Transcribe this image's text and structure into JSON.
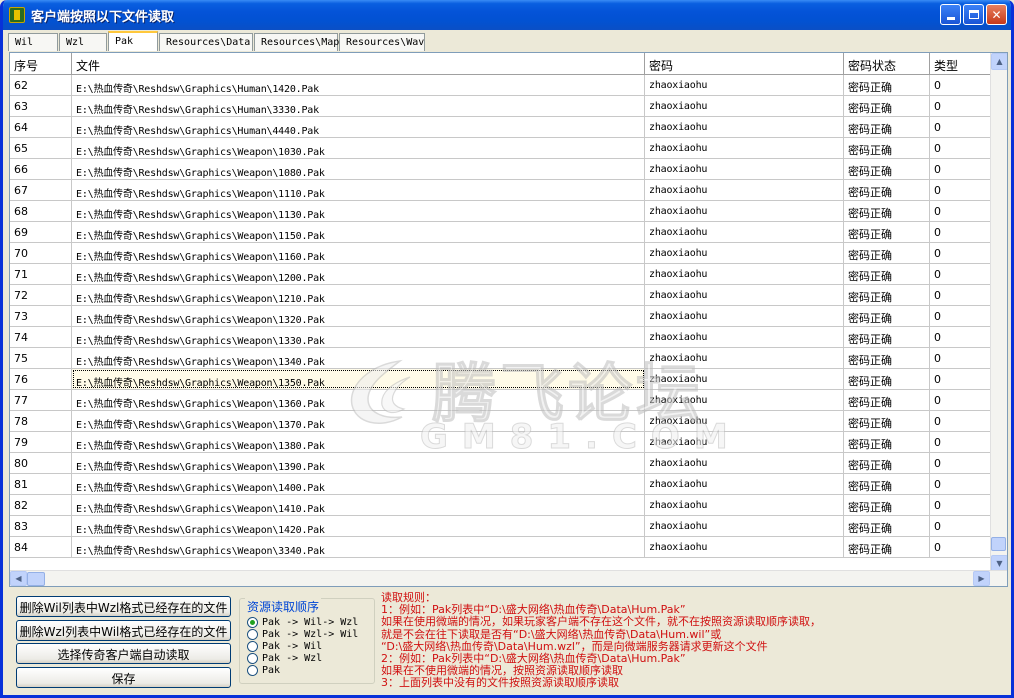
{
  "window": {
    "title": "客户端按照以下文件读取"
  },
  "tabs": [
    {
      "label": "Wil",
      "active": false
    },
    {
      "label": "Wzl",
      "active": false
    },
    {
      "label": "Pak",
      "active": true
    },
    {
      "label": "Resources\\Data",
      "active": false
    },
    {
      "label": "Resources\\Map",
      "active": false
    },
    {
      "label": "Resources\\Wav",
      "active": false
    }
  ],
  "table": {
    "columns": [
      "序号",
      "文件",
      "密码",
      "密码状态",
      "类型"
    ],
    "selected_row": 14,
    "rows": [
      [
        "62",
        "E:\\热血传奇\\Reshdsw\\Graphics\\Human\\1420.Pak",
        "zhaoxiaohu",
        "密码正确",
        "0"
      ],
      [
        "63",
        "E:\\热血传奇\\Reshdsw\\Graphics\\Human\\3330.Pak",
        "zhaoxiaohu",
        "密码正确",
        "0"
      ],
      [
        "64",
        "E:\\热血传奇\\Reshdsw\\Graphics\\Human\\4440.Pak",
        "zhaoxiaohu",
        "密码正确",
        "0"
      ],
      [
        "65",
        "E:\\热血传奇\\Reshdsw\\Graphics\\Weapon\\1030.Pak",
        "zhaoxiaohu",
        "密码正确",
        "0"
      ],
      [
        "66",
        "E:\\热血传奇\\Reshdsw\\Graphics\\Weapon\\1080.Pak",
        "zhaoxiaohu",
        "密码正确",
        "0"
      ],
      [
        "67",
        "E:\\热血传奇\\Reshdsw\\Graphics\\Weapon\\1110.Pak",
        "zhaoxiaohu",
        "密码正确",
        "0"
      ],
      [
        "68",
        "E:\\热血传奇\\Reshdsw\\Graphics\\Weapon\\1130.Pak",
        "zhaoxiaohu",
        "密码正确",
        "0"
      ],
      [
        "69",
        "E:\\热血传奇\\Reshdsw\\Graphics\\Weapon\\1150.Pak",
        "zhaoxiaohu",
        "密码正确",
        "0"
      ],
      [
        "70",
        "E:\\热血传奇\\Reshdsw\\Graphics\\Weapon\\1160.Pak",
        "zhaoxiaohu",
        "密码正确",
        "0"
      ],
      [
        "71",
        "E:\\热血传奇\\Reshdsw\\Graphics\\Weapon\\1200.Pak",
        "zhaoxiaohu",
        "密码正确",
        "0"
      ],
      [
        "72",
        "E:\\热血传奇\\Reshdsw\\Graphics\\Weapon\\1210.Pak",
        "zhaoxiaohu",
        "密码正确",
        "0"
      ],
      [
        "73",
        "E:\\热血传奇\\Reshdsw\\Graphics\\Weapon\\1320.Pak",
        "zhaoxiaohu",
        "密码正确",
        "0"
      ],
      [
        "74",
        "E:\\热血传奇\\Reshdsw\\Graphics\\Weapon\\1330.Pak",
        "zhaoxiaohu",
        "密码正确",
        "0"
      ],
      [
        "75",
        "E:\\热血传奇\\Reshdsw\\Graphics\\Weapon\\1340.Pak",
        "zhaoxiaohu",
        "密码正确",
        "0"
      ],
      [
        "76",
        "E:\\热血传奇\\Reshdsw\\Graphics\\Weapon\\1350.Pak",
        "zhaoxiaohu",
        "密码正确",
        "0"
      ],
      [
        "77",
        "E:\\热血传奇\\Reshdsw\\Graphics\\Weapon\\1360.Pak",
        "zhaoxiaohu",
        "密码正确",
        "0"
      ],
      [
        "78",
        "E:\\热血传奇\\Reshdsw\\Graphics\\Weapon\\1370.Pak",
        "zhaoxiaohu",
        "密码正确",
        "0"
      ],
      [
        "79",
        "E:\\热血传奇\\Reshdsw\\Graphics\\Weapon\\1380.Pak",
        "zhaoxiaohu",
        "密码正确",
        "0"
      ],
      [
        "80",
        "E:\\热血传奇\\Reshdsw\\Graphics\\Weapon\\1390.Pak",
        "zhaoxiaohu",
        "密码正确",
        "0"
      ],
      [
        "81",
        "E:\\热血传奇\\Reshdsw\\Graphics\\Weapon\\1400.Pak",
        "zhaoxiaohu",
        "密码正确",
        "0"
      ],
      [
        "82",
        "E:\\热血传奇\\Reshdsw\\Graphics\\Weapon\\1410.Pak",
        "zhaoxiaohu",
        "密码正确",
        "0"
      ],
      [
        "83",
        "E:\\热血传奇\\Reshdsw\\Graphics\\Weapon\\1420.Pak",
        "zhaoxiaohu",
        "密码正确",
        "0"
      ],
      [
        "84",
        "E:\\热血传奇\\Reshdsw\\Graphics\\Weapon\\3340.Pak",
        "zhaoxiaohu",
        "密码正确",
        "0"
      ]
    ]
  },
  "watermark": {
    "title": "腾飞论坛",
    "subtitle": "GM81.COM"
  },
  "buttons": {
    "delete_wil": "删除Wil列表中Wzl格式已经存在的文件",
    "delete_wzl": "删除Wzl列表中Wil格式已经存在的文件",
    "auto_read": "选择传奇客户端自动读取",
    "save": "保存"
  },
  "order_group": {
    "title": "资源读取顺序",
    "selected": 0,
    "options": [
      "Pak -> Wil-> Wzl",
      "Pak -> Wzl-> Wil",
      "Pak -> Wil",
      "Pak -> Wzl",
      "Pak"
    ]
  },
  "rules": [
    "读取规则：",
    "1：例如：Pak列表中“D:\\盛大网络\\热血传奇\\Data\\Hum.Pak”",
    "    如果在使用微端的情况，如果玩家客户端不存在这个文件，就不在按照资源读取顺序读取，",
    "    就是不会在往下读取是否有“D:\\盛大网络\\热血传奇\\Data\\Hum.wil”或",
    "    “D:\\盛大网络\\热血传奇\\Data\\Hum.wzl”，而是向微端服务器请求更新这个文件",
    "2：例如：Pak列表中“D:\\盛大网络\\热血传奇\\Data\\Hum.Pak”",
    "    如果在不使用微端的情况，按照资源读取顺序读取",
    "3：上面列表中没有的文件按照资源读取顺序读取"
  ],
  "colors": {
    "titlebar": "#0453d8",
    "rules_text": "#d01010",
    "group_title": "#0046d5"
  }
}
